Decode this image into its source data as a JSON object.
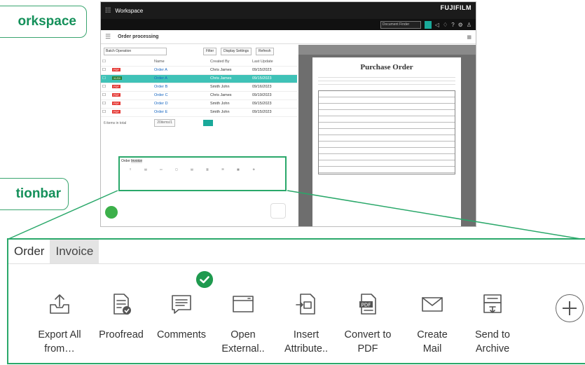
{
  "callouts": {
    "workspace": "orkspace",
    "actionbar": "tionbar"
  },
  "app": {
    "title": "Workspace",
    "brand": "FUJIFILM",
    "doc_search_placeholder": "Document Finder",
    "page_title": "Order processing",
    "toolbar": {
      "batch_operation": "Batch Operation",
      "filter": "Filter",
      "display_settings": "Display Settings",
      "refresh": "Refresh"
    },
    "table": {
      "headers": [
        "Name",
        "Created By",
        "Last Update"
      ],
      "rows": [
        {
          "type": "PDF",
          "name": "Order A",
          "created_by": "Chris James",
          "updated": "09/15/2023"
        },
        {
          "type": "XLSX",
          "name": "Order A",
          "created_by": "Chris James",
          "updated": "09/15/2023"
        },
        {
          "type": "PDF",
          "name": "Order B",
          "created_by": "Smith John",
          "updated": "09/16/2023"
        },
        {
          "type": "PDF",
          "name": "Order C",
          "created_by": "Chris James",
          "updated": "09/19/2023"
        },
        {
          "type": "PDF",
          "name": "Order D",
          "created_by": "Smith John",
          "updated": "09/15/2023"
        },
        {
          "type": "PDF",
          "name": "Order E",
          "created_by": "Smith John",
          "updated": "09/15/2023"
        }
      ]
    },
    "pager": {
      "count": "6 items in total",
      "per_page": "20items/1"
    },
    "document_title": "Purchase Order"
  },
  "actionbar": {
    "tabs": [
      {
        "label": "Order",
        "active": true
      },
      {
        "label": "Invoice",
        "active": false
      }
    ],
    "actions": [
      {
        "id": "export-all",
        "label": "Export All\nfrom…",
        "icon": "export-tray-icon"
      },
      {
        "id": "proofread",
        "label": "Proofread",
        "icon": "proofread-document-icon"
      },
      {
        "id": "comments",
        "label": "Comments",
        "icon": "comment-icon"
      },
      {
        "id": "open-external",
        "label": "Open\nExternal..",
        "icon": "window-icon"
      },
      {
        "id": "insert-attribute",
        "label": "Insert\nAttribute..",
        "icon": "insert-document-icon"
      },
      {
        "id": "convert-to-pdf",
        "label": "Convert to\nPDF",
        "icon": "pdf-document-icon"
      },
      {
        "id": "create-mail",
        "label": "Create\nMail",
        "icon": "mail-icon"
      },
      {
        "id": "send-to-archive",
        "label": "Send to\nArchive",
        "icon": "archive-icon"
      }
    ],
    "add_button_icon": "plus-circle-icon",
    "badge_icon": "check-badge-icon"
  },
  "colors": {
    "accent": "#2aa86a",
    "callout_text": "#14905a",
    "teal": "#3fc2b7",
    "badge": "#1f9a4f"
  }
}
